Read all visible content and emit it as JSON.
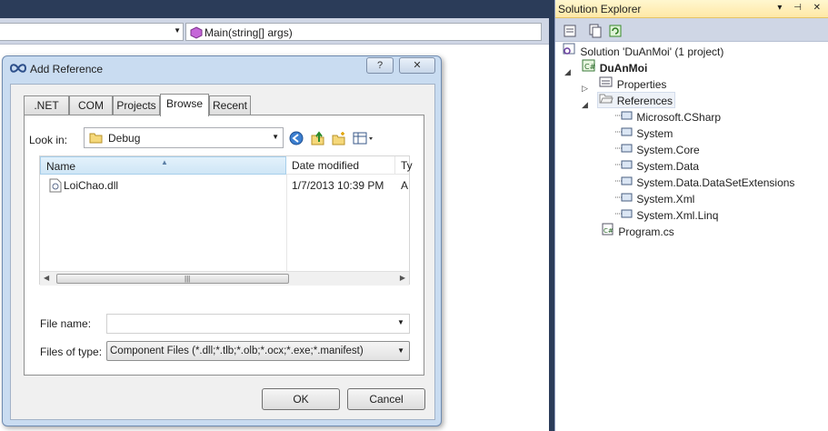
{
  "ide": {
    "member_combo": "Main(string[] args)"
  },
  "solution_explorer": {
    "title": "Solution Explorer",
    "title_buttons": "▾ ⊣ ✕",
    "tree": {
      "solution": "Solution 'DuAnMoi' (1 project)",
      "project": "DuAnMoi",
      "properties": "Properties",
      "references": "References",
      "reference_items": [
        "Microsoft.CSharp",
        "System",
        "System.Core",
        "System.Data",
        "System.Data.DataSetExtensions",
        "System.Xml",
        "System.Xml.Linq"
      ],
      "program_file": "Program.cs"
    }
  },
  "dialog": {
    "title": "Add Reference",
    "help_glyph": "?",
    "close_glyph": "✕",
    "tabs": [
      ".NET",
      "COM",
      "Projects",
      "Browse",
      "Recent"
    ],
    "active_tab": "Browse",
    "look_in_label": "Look in:",
    "look_in_value": "Debug",
    "columns": {
      "name": "Name",
      "date_modified": "Date modified",
      "type": "Ty"
    },
    "files": [
      {
        "name": "LoiChao.dll",
        "date": "1/7/2013 10:39 PM",
        "type": "A"
      }
    ],
    "file_name_label": "File name:",
    "file_name_value": "",
    "files_of_type_label": "Files of type:",
    "files_of_type_value": "Component Files (*.dll;*.tlb;*.olb;*.ocx;*.exe;*.manifest)",
    "ok_label": "OK",
    "cancel_label": "Cancel"
  },
  "colors": {
    "ide_frame": "#2b3c59",
    "dialog_frame": "#c9dcf1",
    "header_selected": "#cfe6f6"
  }
}
